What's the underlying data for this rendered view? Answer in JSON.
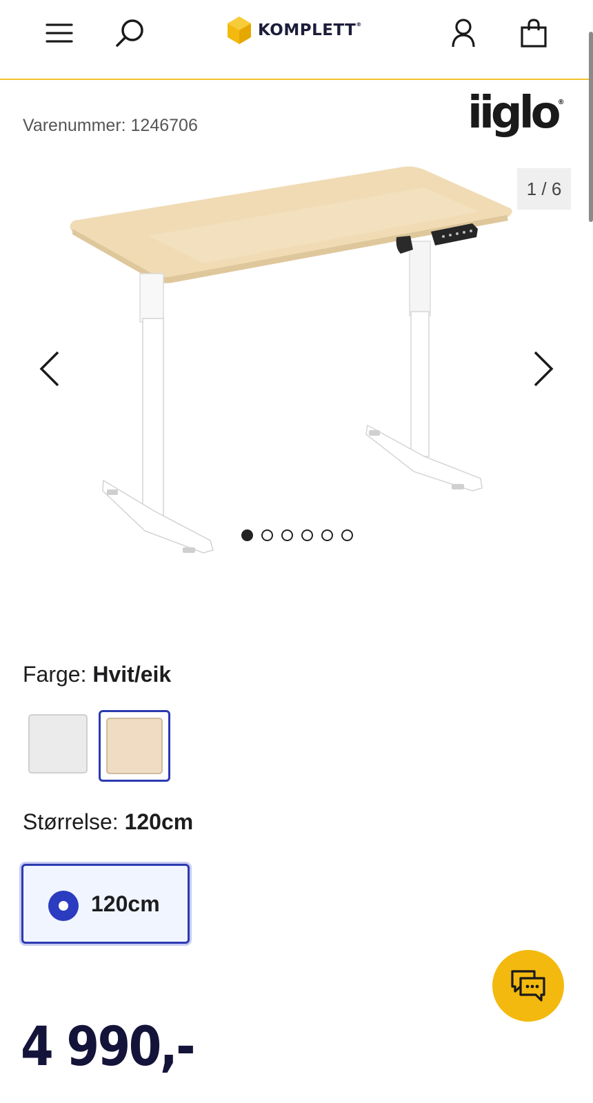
{
  "header": {
    "menu_icon": "hamburger-menu-icon",
    "search_icon": "search-icon",
    "logo_text": "KOMPLETT",
    "logo_reg": "®",
    "account_icon": "user-icon",
    "cart_icon": "shopping-bag-icon",
    "accent_color": "#f2c22a"
  },
  "product": {
    "sku_label": "Varenummer: 1246706",
    "brand": "iiglo",
    "brand_reg": "®",
    "image_counter": "1 / 6",
    "image_dots": 6,
    "active_dot": 0
  },
  "options": {
    "color_label": "Farge:",
    "color_value": "Hvit/eik",
    "swatches": [
      {
        "name": "Hvit",
        "color": "#ebebeb",
        "selected": false
      },
      {
        "name": "Hvit/eik",
        "color": "#efdcc3",
        "selected": true
      }
    ],
    "size_label": "Størrelse:",
    "size_value": "120cm",
    "sizes": [
      {
        "label": "120cm",
        "selected": true
      }
    ]
  },
  "price": "4 990,-",
  "chat_icon": "chat-bubbles-icon",
  "colors": {
    "primary_blue": "#2c3cc0",
    "chat_yellow": "#f4b90e",
    "price_navy": "#14143a"
  }
}
